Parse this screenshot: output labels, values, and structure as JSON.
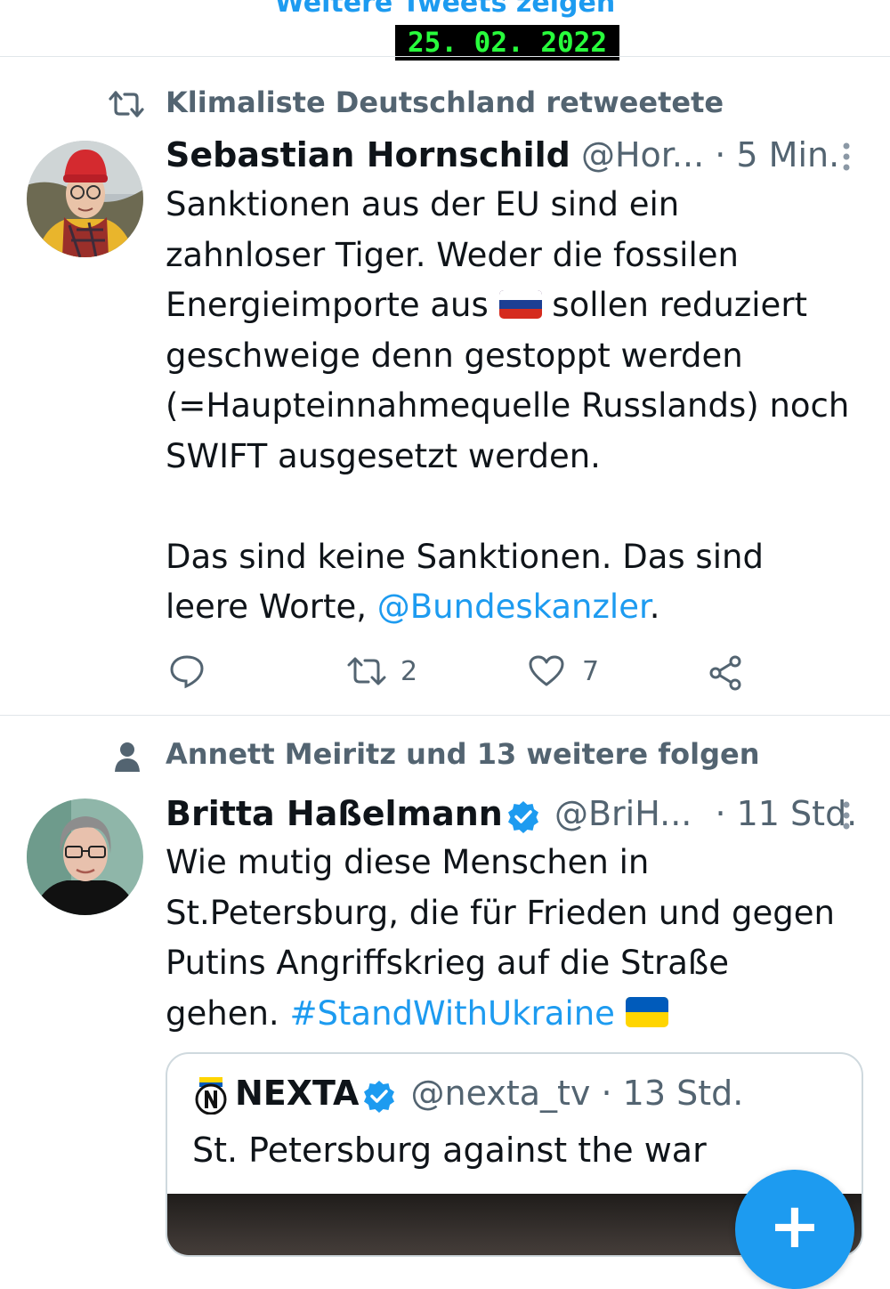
{
  "top": {
    "show_more_label": "Weitere Tweets zeigen",
    "date_stamp": "25. 02. 2022"
  },
  "tweet1": {
    "context": "Klimaliste Deutschland retweetete",
    "name": "Sebastian Hornschild",
    "handle": "@Hor...",
    "time": "· 5 Min.",
    "text_1": "Sanktionen aus der EU sind ein\nzahnloser Tiger. Weder die fossilen\nEnergieimporte aus ",
    "text_flag": "russia-flag",
    "text_2": " sollen reduziert\ngeschweige denn gestoppt werden\n(=Haupteinnahmequelle Russlands) noch\nSWIFT ausgesetzt werden.\n\nDas sind keine Sanktionen. Das sind\nleere Worte, ",
    "mention": "@Bundeskanzler",
    "text_end": ".",
    "retweets": "2",
    "likes": "7"
  },
  "tweet2": {
    "context": "Annett Meiritz und 13 weitere folgen",
    "name": "Britta Haßelmann",
    "handle": "@BriH...",
    "time": "· 11 Std.",
    "text_1": "Wie mutig diese Menschen in\nSt.Petersburg, die für Frieden und gegen\nPutins Angriffskrieg auf die Straße\ngehen. ",
    "hashtag": "#StandWithUkraine",
    "text_flag": "ukraine-flag",
    "quote": {
      "name": "NEXTA",
      "handle_time": "@nexta_tv · 13 Std.",
      "text": "St. Petersburg against the war"
    }
  },
  "fab": {
    "label": "+"
  },
  "colors": {
    "accent": "#1d9bf0",
    "muted": "#536471",
    "text": "#0f1419"
  }
}
